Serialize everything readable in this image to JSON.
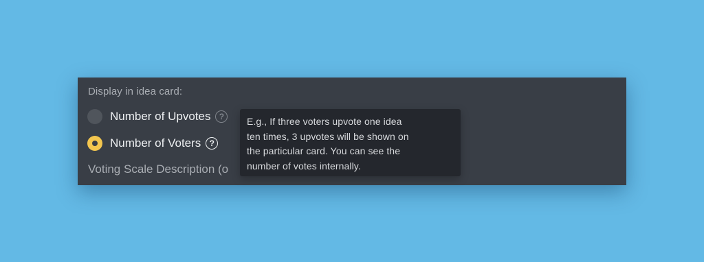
{
  "display_settings": {
    "section_label": "Display in idea card:",
    "options": [
      {
        "label": "Number of Upvotes",
        "selected": false
      },
      {
        "label": "Number of Voters",
        "selected": true
      }
    ],
    "help_icon_glyph": "?",
    "voting_scale_label": "Voting Scale Description (o"
  },
  "tooltip": {
    "lines": [
      "E.g., If three voters upvote one idea",
      "ten times, 3 upvotes will be shown on",
      "the particular card. You can see the",
      "number of votes internally."
    ]
  },
  "colors": {
    "background": "#63b9e5",
    "panel": "#393e46",
    "tooltip": "#24272d",
    "radio_selected": "#f3c64f",
    "radio_unselected": "#50555c"
  }
}
